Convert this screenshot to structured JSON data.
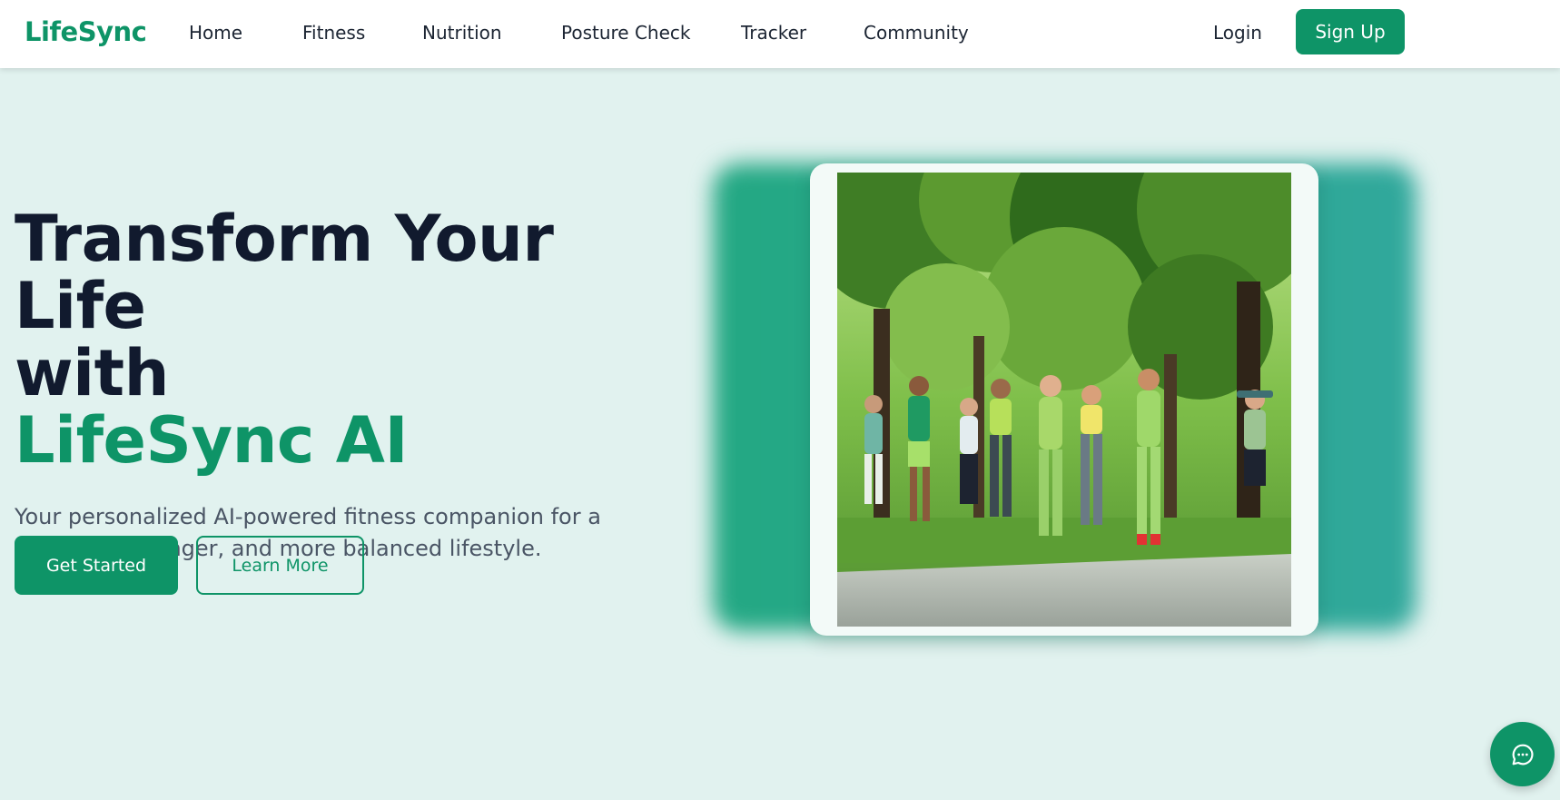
{
  "brand": {
    "name": "LifeSync"
  },
  "nav": {
    "links": [
      "Home",
      "Fitness",
      "Nutrition",
      "Posture Check",
      "Tracker",
      "Community"
    ],
    "login": "Login",
    "signup": "Sign Up"
  },
  "hero": {
    "headline_line1": "Transform Your Life",
    "headline_line2": "with",
    "headline_accent": "LifeSync AI",
    "subtitle": "Your personalized AI-powered fitness companion for a healthier, stronger, and more balanced lifestyle.",
    "primary_button": "Get Started",
    "secondary_button": "Learn More"
  },
  "image": {
    "subject": "group-running-in-park"
  },
  "icons": {
    "chat": "chat-bubble-icon"
  },
  "colors": {
    "brand_green": "#0e9467",
    "page_bg": "#e1f2ef",
    "heading_dark": "#111a2e",
    "glow_teal": "#2aa68e"
  }
}
